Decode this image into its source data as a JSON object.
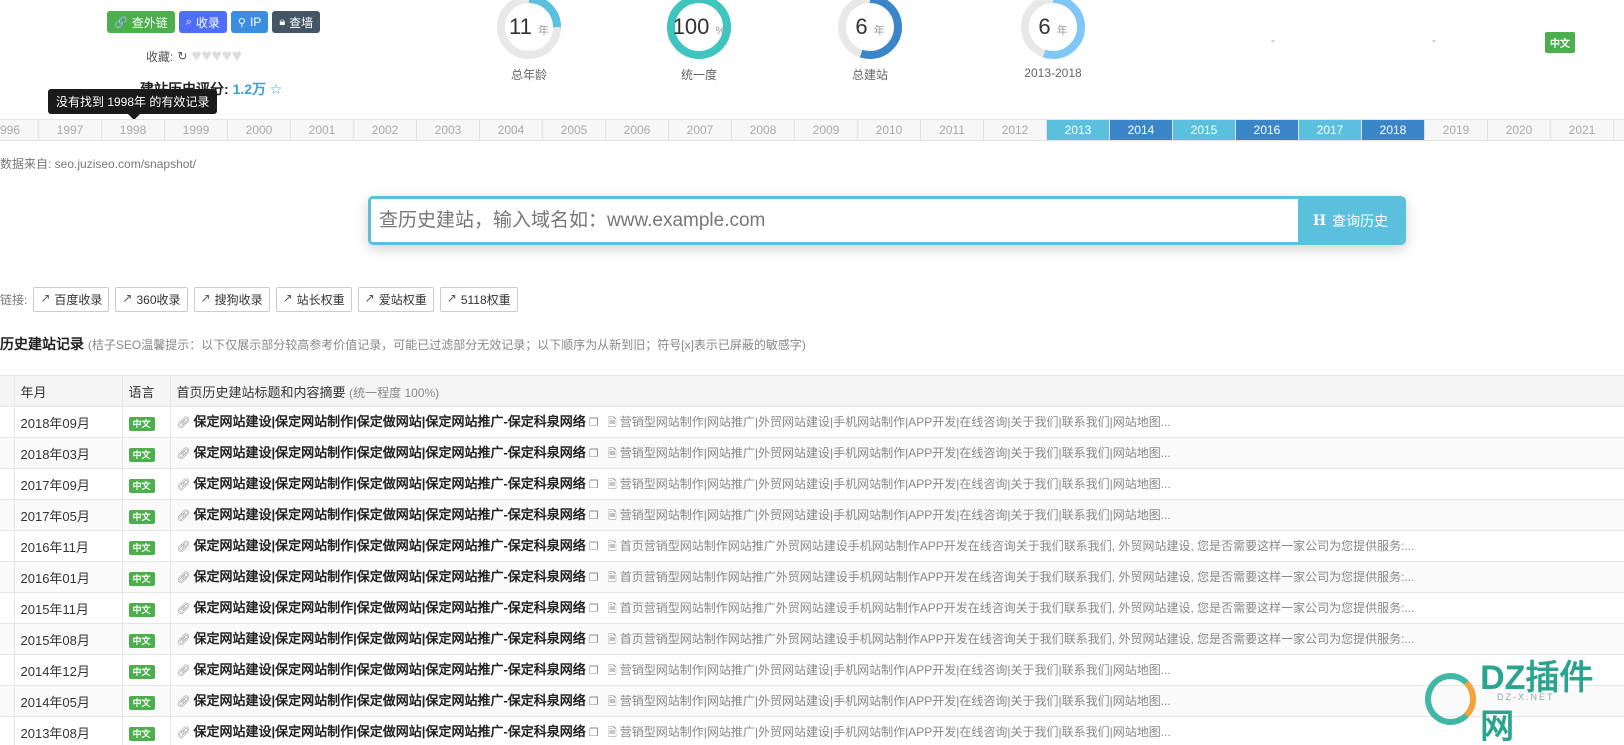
{
  "buttons": {
    "outlink": "查外链",
    "index": "收录",
    "ip": "IP",
    "wall": "查墙"
  },
  "fav_label": "收藏:",
  "fav_refresh": "↻",
  "rating": {
    "label": "建站历史评分:",
    "value": "1.2万",
    "star": "☆"
  },
  "tooltip": "没有找到 1998年 的有效记录",
  "gauges": [
    {
      "value": "11",
      "unit": "年",
      "caption": "总年龄",
      "fraction": 0.25,
      "color": "#5bc0de"
    },
    {
      "value": "100",
      "unit": "%",
      "caption": "统一度",
      "fraction": 1.0,
      "color": "#3ec5c0"
    },
    {
      "value": "6",
      "unit": "年",
      "caption": "总建站",
      "fraction": 0.55,
      "color": "#3a86c8"
    },
    {
      "value": "6",
      "unit": "年",
      "caption": "2013-2018",
      "fraction": 0.55,
      "color": "#7fc7f5"
    }
  ],
  "dash1": "-",
  "dash2": "-",
  "lang_top": "中文",
  "years": [
    "996",
    "1997",
    "1998",
    "1999",
    "2000",
    "2001",
    "2002",
    "2003",
    "2004",
    "2005",
    "2006",
    "2007",
    "2008",
    "2009",
    "2010",
    "2011",
    "2012",
    "2013",
    "2014",
    "2015",
    "2016",
    "2017",
    "2018",
    "2019",
    "2020",
    "2021",
    "20"
  ],
  "active_years_light": [
    "2013",
    "2015",
    "2017"
  ],
  "active_years_dark": [
    "2014",
    "2016",
    "2018"
  ],
  "source": "数据来自: seo.juziseo.com/snapshot/",
  "search": {
    "placeholder": "查历史建站，输入域名如：www.example.com",
    "button_icon": "H",
    "button": "查询历史"
  },
  "links": {
    "label": "链接:",
    "items": [
      "百度收录",
      "360收录",
      "搜狗收录",
      "站长权重",
      "爱站权重",
      "5118权重"
    ]
  },
  "section": {
    "title": "历史建站记录",
    "note": "(桔子SEO温馨提示：以下仅展示部分较高参考价值记录，可能已过滤部分无效记录；以下顺序为从新到旧；符号[x]表示已屏蔽的敏感字)"
  },
  "table": {
    "headers": {
      "date": "年月",
      "lang": "语言",
      "content": "首页历史建站标题和内容摘要",
      "content_note": "(统一程度 100%)"
    },
    "rows": [
      {
        "date": "2018年09月",
        "lang": "中文",
        "title": "保定网站建设|保定网站制作|保定做网站|保定网站推广-保定科泉网络",
        "desc": "营销型网站制作|网站推广|外贸网站建设|手机网站制作|APP开发|在线咨询|关于我们|联系我们|网站地图..."
      },
      {
        "date": "2018年03月",
        "lang": "中文",
        "title": "保定网站建设|保定网站制作|保定做网站|保定网站推广-保定科泉网络",
        "desc": "营销型网站制作|网站推广|外贸网站建设|手机网站制作|APP开发|在线咨询|关于我们|联系我们|网站地图..."
      },
      {
        "date": "2017年09月",
        "lang": "中文",
        "title": "保定网站建设|保定网站制作|保定做网站|保定网站推广-保定科泉网络",
        "desc": "营销型网站制作|网站推广|外贸网站建设|手机网站制作|APP开发|在线咨询|关于我们|联系我们|网站地图..."
      },
      {
        "date": "2017年05月",
        "lang": "中文",
        "title": "保定网站建设|保定网站制作|保定做网站|保定网站推广-保定科泉网络",
        "desc": "营销型网站制作|网站推广|外贸网站建设|手机网站制作|APP开发|在线咨询|关于我们|联系我们|网站地图..."
      },
      {
        "date": "2016年11月",
        "lang": "中文",
        "title": "保定网站建设|保定网站制作|保定做网站|保定网站推广-保定科泉网络",
        "desc": "首页营销型网站制作网站推广外贸网站建设手机网站制作APP开发在线咨询关于我们联系我们, 外贸网站建设, 您是否需要这样一家公司为您提供服务:..."
      },
      {
        "date": "2016年01月",
        "lang": "中文",
        "title": "保定网站建设|保定网站制作|保定做网站|保定网站推广-保定科泉网络",
        "desc": "首页营销型网站制作网站推广外贸网站建设手机网站制作APP开发在线咨询关于我们联系我们, 外贸网站建设, 您是否需要这样一家公司为您提供服务:..."
      },
      {
        "date": "2015年11月",
        "lang": "中文",
        "title": "保定网站建设|保定网站制作|保定做网站|保定网站推广-保定科泉网络",
        "desc": "首页营销型网站制作网站推广外贸网站建设手机网站制作APP开发在线咨询关于我们联系我们, 外贸网站建设, 您是否需要这样一家公司为您提供服务:..."
      },
      {
        "date": "2015年08月",
        "lang": "中文",
        "title": "保定网站建设|保定网站制作|保定做网站|保定网站推广-保定科泉网络",
        "desc": "首页营销型网站制作网站推广外贸网站建设手机网站制作APP开发在线咨询关于我们联系我们, 外贸网站建设, 您是否需要这样一家公司为您提供服务:..."
      },
      {
        "date": "2014年12月",
        "lang": "中文",
        "title": "保定网站建设|保定网站制作|保定做网站|保定网站推广-保定科泉网络",
        "desc": "营销型网站制作|网站推广|外贸网站建设|手机网站制作|APP开发|在线咨询|关于我们|联系我们|网站地图..."
      },
      {
        "date": "2014年05月",
        "lang": "中文",
        "title": "保定网站建设|保定网站制作|保定做网站|保定网站推广-保定科泉网络",
        "desc": "营销型网站制作|网站推广|外贸网站建设|手机网站制作|APP开发|在线咨询|关于我们|联系我们|网站地图..."
      },
      {
        "date": "2013年08月",
        "lang": "中文",
        "title": "保定网站建设|保定网站制作|保定做网站|保定网站推广-保定科泉网络",
        "desc": "营销型网站制作|网站推广|外贸网站建设|手机网站制作|APP开发|在线咨询|关于我们|联系我们|网站地图..."
      }
    ]
  },
  "watermark": {
    "text": "DZ插件网",
    "sub": "DZ-X.NET"
  }
}
